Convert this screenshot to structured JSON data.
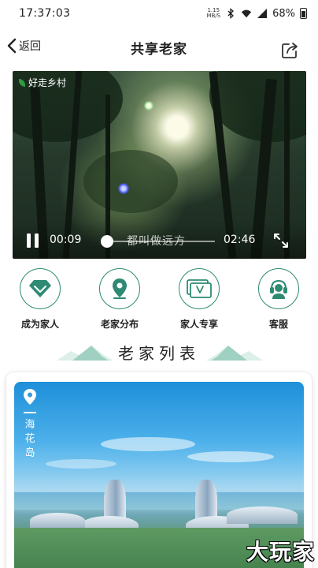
{
  "status_bar": {
    "time": "17:37:03",
    "net_speed_value": "1.15",
    "net_speed_unit": "MB/S",
    "battery": "68%"
  },
  "nav": {
    "back_label": "返回",
    "title": "共享老家"
  },
  "video": {
    "watermark": "好走乡村",
    "current_time": "00:09",
    "total_time": "02:46",
    "subtitle": "都叫做远方",
    "progress": 0.055
  },
  "quick_actions": [
    {
      "label": "成为家人",
      "icon": "gem-icon"
    },
    {
      "label": "老家分布",
      "icon": "location-pin-icon"
    },
    {
      "label": "家人专享",
      "icon": "vip-card-icon"
    },
    {
      "label": "客服",
      "icon": "customer-service-icon"
    }
  ],
  "section": {
    "title": "老家列表"
  },
  "list": {
    "items": [
      {
        "name": "海花岛",
        "chars": [
          "海",
          "花",
          "岛"
        ]
      }
    ]
  },
  "corner_watermark": "大玩家",
  "colors": {
    "accent": "#2e8a73",
    "text": "#222222",
    "background": "#ffffff"
  }
}
